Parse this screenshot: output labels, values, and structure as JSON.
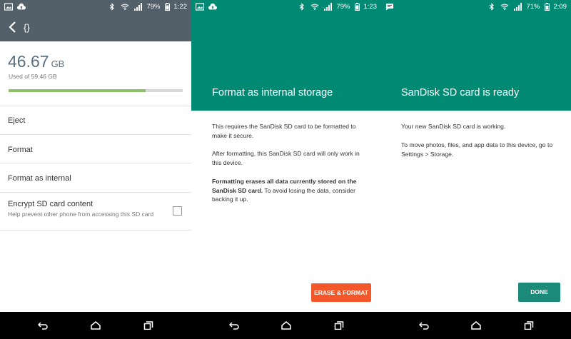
{
  "panel1": {
    "status": {
      "battery": "79%",
      "time": "1:22"
    },
    "title": "{}",
    "storage": {
      "used_value": "46.67",
      "used_unit": "GB",
      "used_caption": "Used of 59.46 GB",
      "used_fraction": 0.785
    },
    "items": [
      {
        "label": "Eject"
      },
      {
        "label": "Format"
      },
      {
        "label": "Format as internal"
      }
    ],
    "encrypt": {
      "label": "Encrypt SD card content",
      "description": "Help prevent other phone from accessing this SD card",
      "checked": false
    }
  },
  "panel2": {
    "status": {
      "battery": "79%",
      "time": "1:23"
    },
    "header_title": "Format as internal storage",
    "para1": "This requires the SanDisk SD card to be formatted to make it secure.",
    "para2": "After formatting, this SanDisk SD card will only work in this device.",
    "para3_bold": "Formatting erases all data currently stored on the SanDisk SD card.",
    "para3_rest": " To avoid losing the data, consider backing it up.",
    "button": "ERASE & FORMAT",
    "colors": {
      "header": "#008a74",
      "button": "#f2582a"
    }
  },
  "panel3": {
    "status": {
      "battery": "71%",
      "time": "2:09"
    },
    "header_title": "SanDisk SD card is ready",
    "para1": "Your new SanDisk SD card is working.",
    "para2": "To move photos, files, and app data to this device, go to Settings > Storage.",
    "button": "DONE",
    "colors": {
      "header": "#008a74",
      "button": "#1b8a79"
    }
  },
  "icons": {
    "status_left": [
      "gallery-icon",
      "cloud-upload-icon",
      "message-icon"
    ],
    "status_right": [
      "bluetooth-icon",
      "wifi-icon",
      "signal-icon",
      "battery-icon"
    ],
    "nav": [
      "back-icon",
      "home-icon",
      "recents-icon"
    ]
  }
}
